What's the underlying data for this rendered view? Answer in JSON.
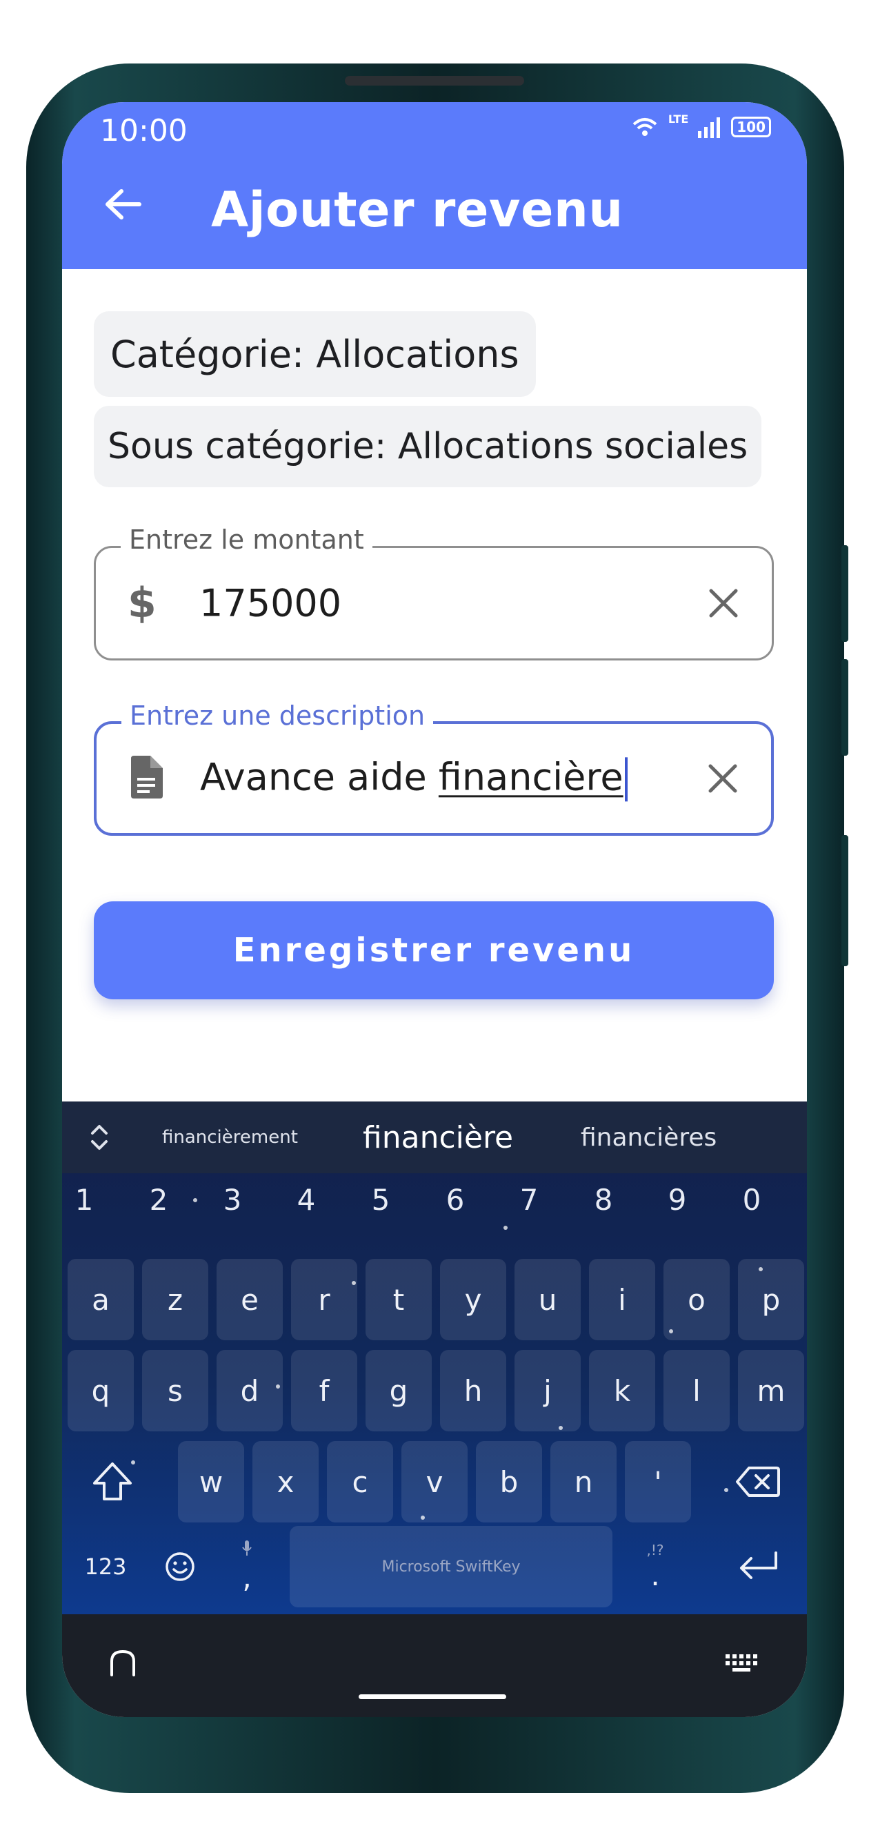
{
  "status": {
    "time": "10:00",
    "signal_label": "LTE",
    "battery": "100"
  },
  "app_bar": {
    "title": "Ajouter revenu"
  },
  "category_chip": "Catégorie: Allocations",
  "subcategory_chip": "Sous catégorie: Allocations sociales",
  "amount_field": {
    "label": "Entrez le montant",
    "value": "175000"
  },
  "description_field": {
    "label": "Entrez une description",
    "value_prefix": "Avance aide ",
    "value_underlined": "financière"
  },
  "save_button": {
    "label": "Enregistrer revenu"
  },
  "keyboard": {
    "suggestions": [
      "financièrement",
      "financière",
      "financières"
    ],
    "numbers": [
      "1",
      "2",
      "3",
      "4",
      "5",
      "6",
      "7",
      "8",
      "9",
      "0"
    ],
    "row1": [
      "a",
      "z",
      "e",
      "r",
      "t",
      "y",
      "u",
      "i",
      "o",
      "p"
    ],
    "row2": [
      "q",
      "s",
      "d",
      "f",
      "g",
      "h",
      "j",
      "k",
      "l",
      "m"
    ],
    "row3": [
      "w",
      "x",
      "c",
      "v",
      "b",
      "n",
      "'"
    ],
    "bottom": {
      "numeric_label": "123",
      "comma": ",",
      "space_label": "Microsoft SwiftKey",
      "period": ".",
      "period_hint": ",!?"
    }
  },
  "colors": {
    "accent": "#5b7bfb",
    "focus_border": "#5a70d6",
    "keyboard_bg": "#10295c"
  }
}
